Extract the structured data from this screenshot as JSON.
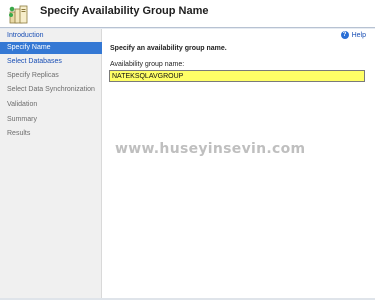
{
  "header": {
    "title": "Specify Availability Group Name",
    "icon": "server-cluster-icon"
  },
  "sidebar": {
    "items": [
      {
        "label": "Introduction",
        "state": "link"
      },
      {
        "label": "Specify Name",
        "state": "active"
      },
      {
        "label": "Select Databases",
        "state": "link"
      },
      {
        "label": "Specify Replicas",
        "state": "disabled"
      },
      {
        "label": "Select Data Synchronization",
        "state": "disabled"
      },
      {
        "label": "Validation",
        "state": "disabled"
      },
      {
        "label": "Summary",
        "state": "disabled"
      },
      {
        "label": "Results",
        "state": "disabled"
      }
    ]
  },
  "main": {
    "help_label": "Help",
    "section_title": "Specify an availability group name.",
    "field_label": "Availability group name:",
    "field_value": "NATEKSQLAVGROUP"
  },
  "watermark": "www.huseyinsevin.com",
  "colors": {
    "active_item": "#3478d4",
    "link": "#1a4fb5",
    "input_highlight": "#ffff66"
  }
}
